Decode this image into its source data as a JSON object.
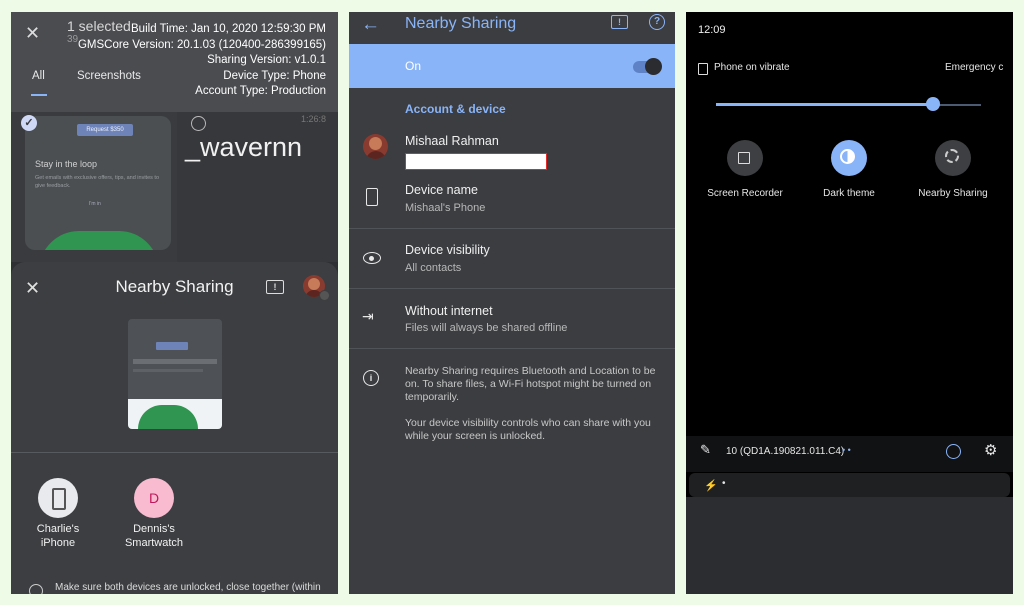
{
  "panel1": {
    "selection": {
      "title": "1 selected",
      "sub": "39"
    },
    "build_info": [
      "Build Time: Jan 10, 2020 12:59:30 PM",
      "GMSCore Version: 20.1.03 (120400-286399165)",
      "Sharing Version: v1.0.1",
      "Device Type: Phone",
      "Account Type: Production"
    ],
    "tabs": [
      "All",
      "Screenshots"
    ],
    "thumb1": {
      "button": "Request $350",
      "heading": "Stay in the loop",
      "body": "Get emails with exclusive offers, tips, and invites to give feedback.",
      "link": "I'm in"
    },
    "thumb2": {
      "text": "_wavernn",
      "num": "1:26:8"
    },
    "sheet": {
      "title": "Nearby Sharing",
      "devices": [
        {
          "name": "Charlie's iPhone",
          "initial": "",
          "color": "#e8eaed"
        },
        {
          "name": "Dennis's Smartwatch",
          "initial": "D",
          "color": "#f8bbd0"
        }
      ],
      "hint": "Make sure both devices are unlocked, close together (within"
    }
  },
  "panel2": {
    "title": "Nearby Sharing",
    "toggle_label": "On",
    "section_title": "Account & device",
    "account_name": "Mishaal Rahman",
    "device_name": {
      "title": "Device name",
      "value": "Mishaal's Phone"
    },
    "visibility": {
      "title": "Device visibility",
      "value": "All contacts"
    },
    "internet": {
      "title": "Without internet",
      "value": "Files will always be shared offline"
    },
    "info1": "Nearby Sharing requires Bluetooth and Location to be on. To share files, a Wi-Fi hotspot might be turned on temporarily.",
    "info2": "Your device visibility controls who can share with you while your screen is unlocked.",
    "accent": "#8ab4f8"
  },
  "panel3": {
    "time": "12:09",
    "status": "Phone on vibrate",
    "emergency": "Emergency c",
    "brightness": 0.82,
    "tiles": [
      {
        "label": "Screen Recorder",
        "active": false,
        "icon": "screen-recorder-icon"
      },
      {
        "label": "Dark theme",
        "active": true,
        "icon": "dark-theme-icon"
      },
      {
        "label": "Nearby Sharing",
        "active": false,
        "icon": "nearby-sharing-icon"
      }
    ],
    "build": "10 (QD1A.190821.011.C4)"
  }
}
